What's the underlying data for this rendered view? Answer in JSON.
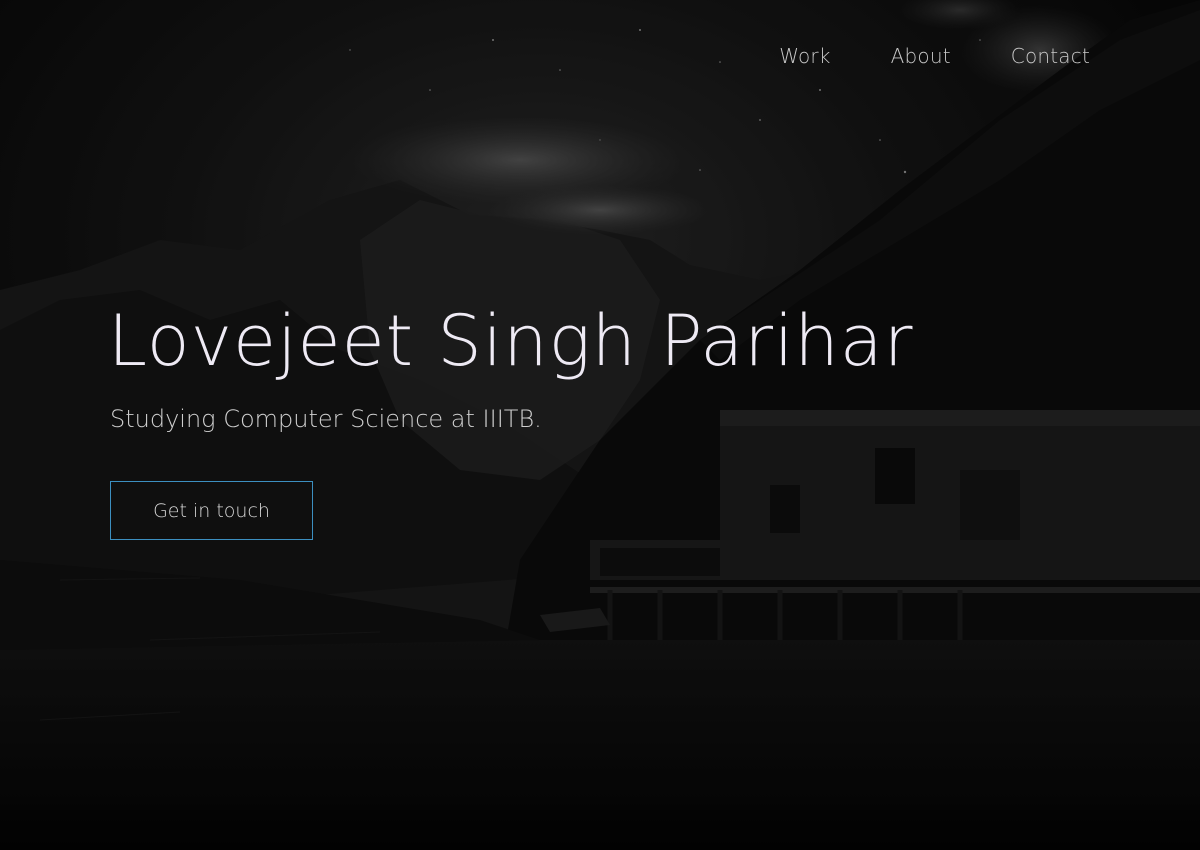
{
  "nav": {
    "items": [
      {
        "label": "Work"
      },
      {
        "label": "About"
      },
      {
        "label": "Contact"
      }
    ]
  },
  "hero": {
    "title": "Lovejeet Singh Parihar",
    "subtitle": "Studying Computer Science at IIITB.",
    "cta_label": "Get in touch"
  },
  "colors": {
    "background": "#050505",
    "title_text": "#eeeaf4",
    "nav_text": "#c9c9c9",
    "button_border": "#3c8fc0"
  }
}
